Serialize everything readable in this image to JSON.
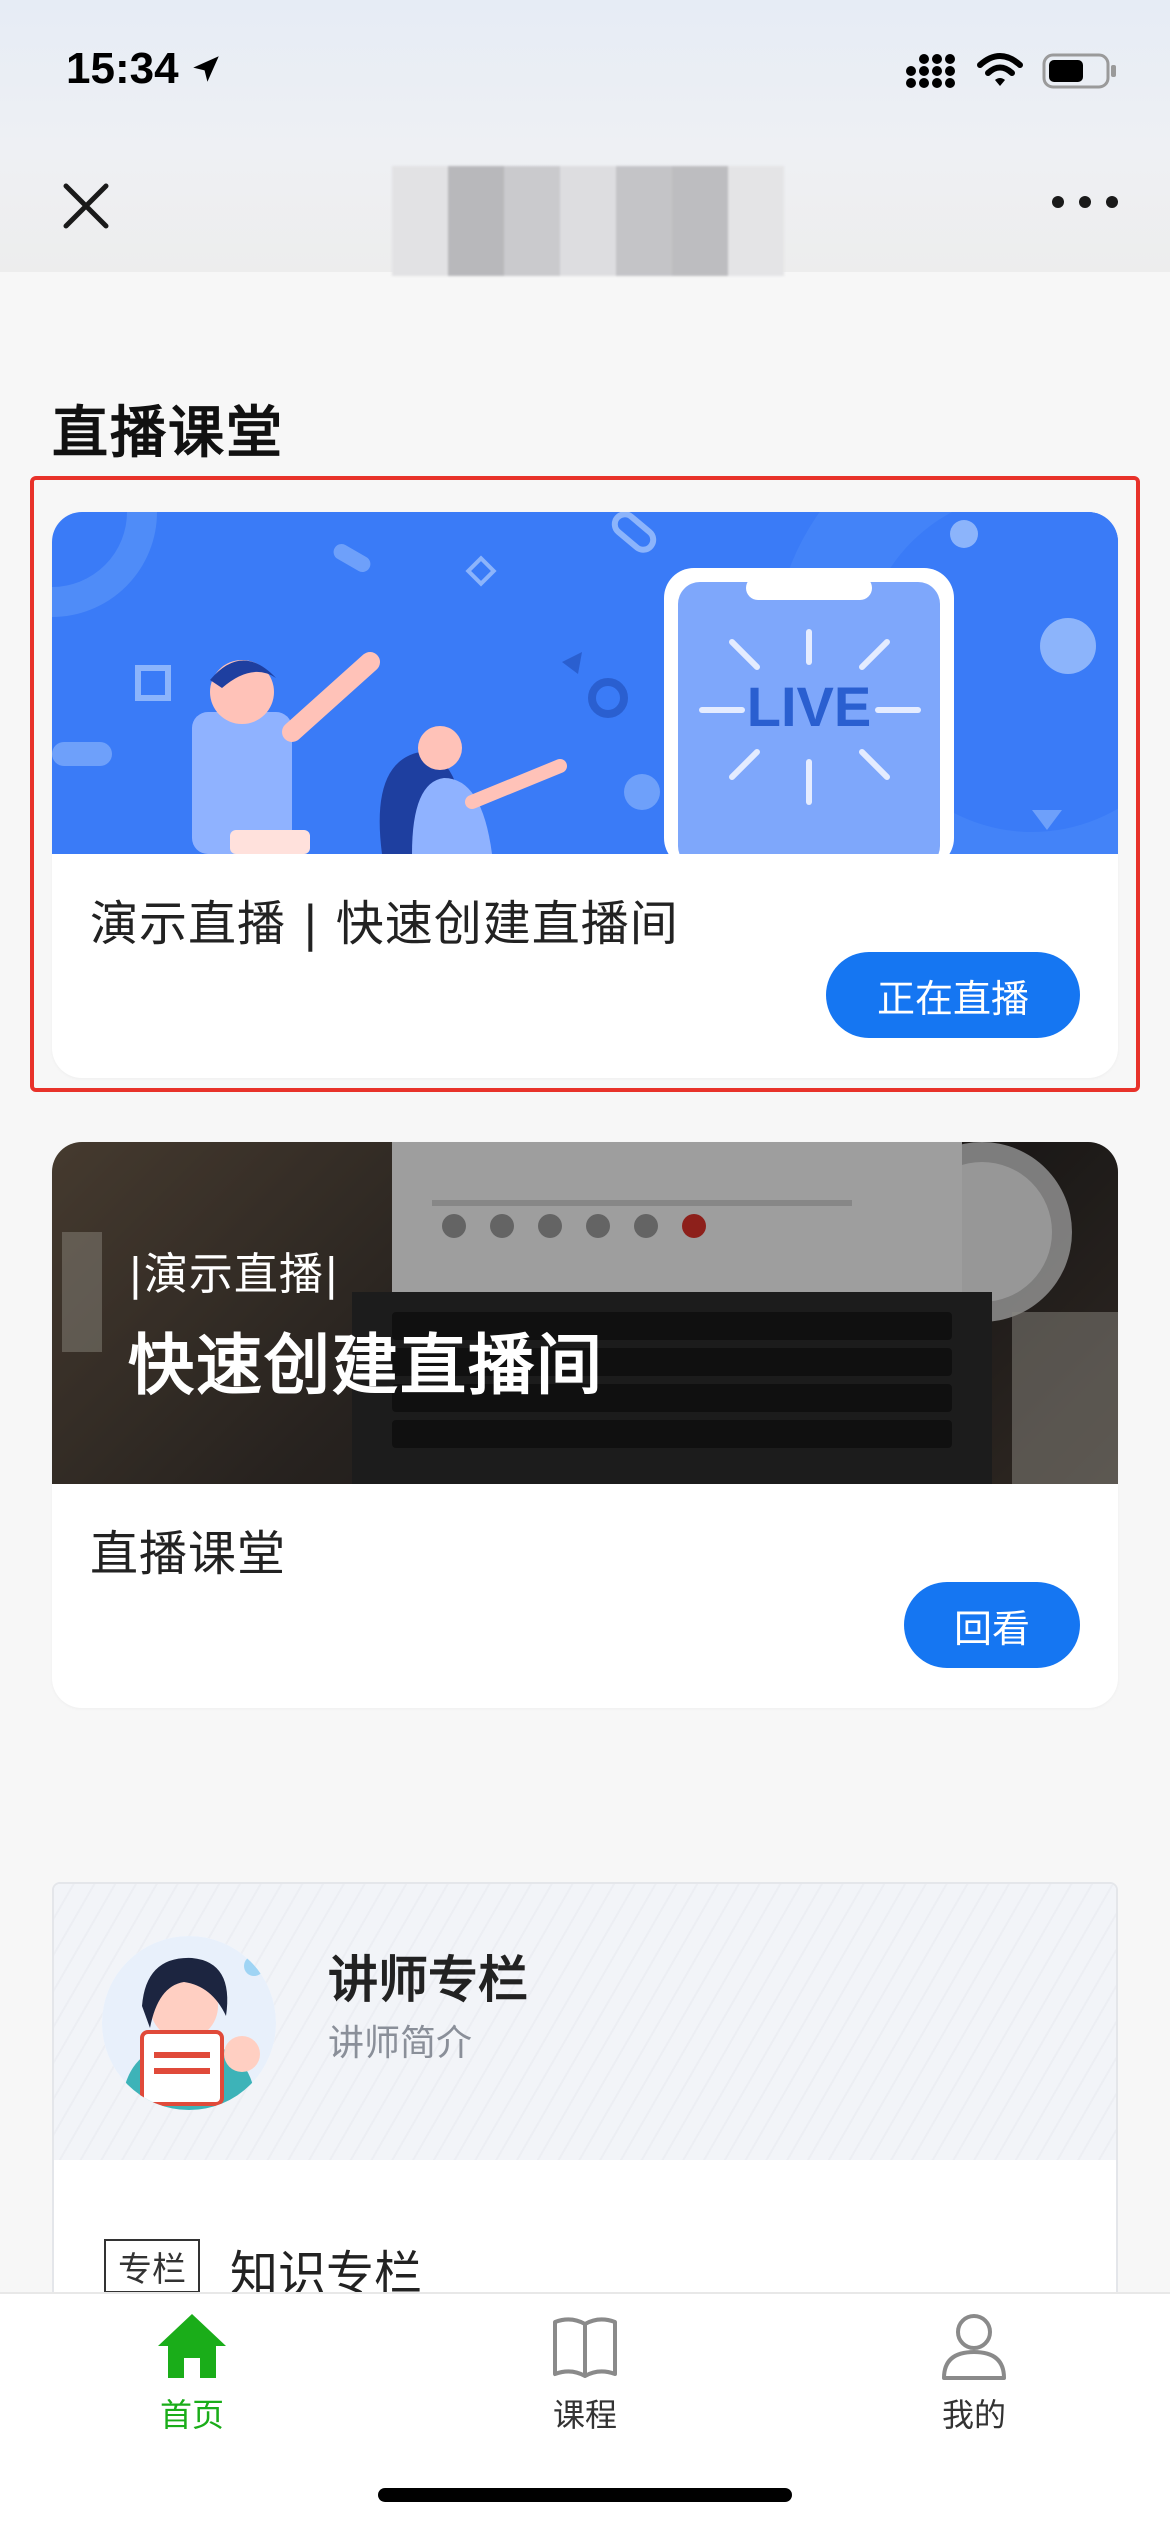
{
  "status_bar": {
    "time": "15:34"
  },
  "nav": {
    "close_icon": "close-icon",
    "more_icon": "more-icon"
  },
  "section": {
    "title": "直播课堂"
  },
  "cards": [
    {
      "banner_text": "LIVE",
      "title": "演示直播 | 快速创建直播间",
      "button": "正在直播",
      "accent": "#3a7bf7"
    },
    {
      "banner_small": "|演示直播|",
      "banner_big": "快速创建直播间",
      "title": "直播课堂",
      "button": "回看"
    }
  ],
  "lecturer": {
    "name": "讲师专栏",
    "subtitle": "讲师简介",
    "column_tag": "专栏",
    "column_title": "知识专栏"
  },
  "tabbar": {
    "items": [
      {
        "label": "首页",
        "icon": "home-icon",
        "active": true
      },
      {
        "label": "课程",
        "icon": "book-icon",
        "active": false
      },
      {
        "label": "我的",
        "icon": "user-icon",
        "active": false
      }
    ],
    "active_color": "#1aad19"
  },
  "colors": {
    "primary_button": "#1576f2",
    "highlight_border": "#e8322a"
  }
}
